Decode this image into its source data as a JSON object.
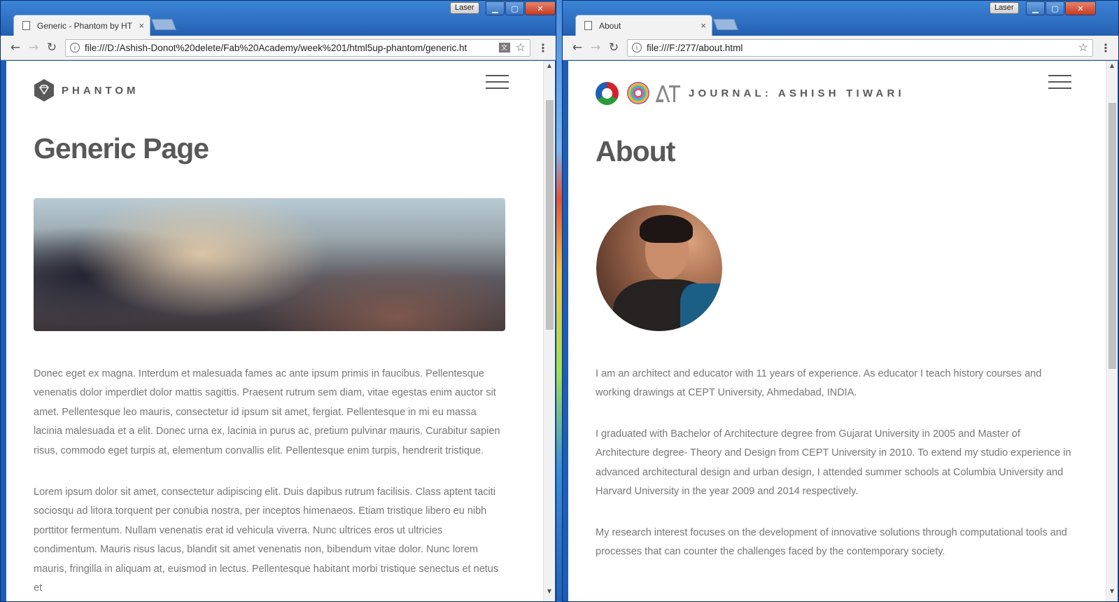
{
  "left_window": {
    "laser_label": "Laser",
    "tab": {
      "title": "Generic - Phantom by HT",
      "close": "×"
    },
    "address": {
      "url": "file:///D:/Ashish-Donot%20delete/Fab%20Academy/week%201/html5up-phantom/generic.ht"
    },
    "site": {
      "logo_text": "PHANTOM",
      "heading": "Generic Page",
      "paragraphs": [
        "Donec eget ex magna. Interdum et malesuada fames ac ante ipsum primis in faucibus. Pellentesque venenatis dolor imperdiet dolor mattis sagittis. Praesent rutrum sem diam, vitae egestas enim auctor sit amet. Pellentesque leo mauris, consectetur id ipsum sit amet, fergiat. Pellentesque in mi eu massa lacinia malesuada et a elit. Donec urna ex, lacinia in purus ac, pretium pulvinar mauris. Curabitur sapien risus, commodo eget turpis at, elementum convallis elit. Pellentesque enim turpis, hendrerit tristique.",
        "Lorem ipsum dolor sit amet, consectetur adipiscing elit. Duis dapibus rutrum facilisis. Class aptent taciti sociosqu ad litora torquent per conubia nostra, per inceptos himenaeos. Etiam tristique libero eu nibh porttitor fermentum. Nullam venenatis erat id vehicula viverra. Nunc ultrices eros ut ultricies condimentum. Mauris risus lacus, blandit sit amet venenatis non, bibendum vitae dolor. Nunc lorem mauris, fringilla in aliquam at, euismod in lectus. Pellentesque habitant morbi tristique senectus et netus et"
      ]
    }
  },
  "right_window": {
    "laser_label": "Laser",
    "tab": {
      "title": "About",
      "close": "×"
    },
    "address": {
      "url": "file:///F:/277/about.html"
    },
    "site": {
      "journal_title": "JOURNAL: ASHISH TIWARI",
      "heading": "About",
      "paragraphs": [
        "I am an architect and educator with 11 years of experience. As educator I teach history courses and working drawings at CEPT University, Ahmedabad, INDIA.",
        "I graduated with Bachelor of Architecture degree from Gujarat University in 2005 and Master of Architecture degree- Theory and Design from CEPT University in 2010. To extend my studio experience in advanced architectural design and urban design, I attended summer schools at Columbia University and Harvard University in the year 2009 and 2014 respectively.",
        "My research interest focuses on the development of innovative solutions through computational tools and processes that can counter the challenges faced by the contemporary society."
      ]
    }
  },
  "icons": {
    "back": "back-arrow-icon",
    "forward": "forward-arrow-icon",
    "reload": "reload-icon",
    "star": "bookmark-star-icon",
    "menu": "kebab-menu-icon",
    "hamburger": "hamburger-menu-icon"
  }
}
